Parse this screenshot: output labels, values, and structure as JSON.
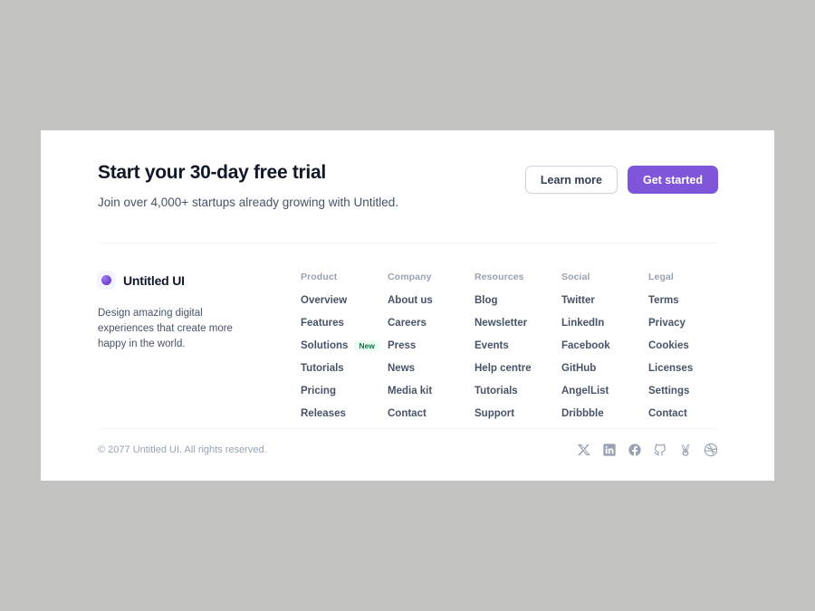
{
  "cta": {
    "title": "Start your 30-day free trial",
    "subtitle": "Join over 4,000+ startups already growing with Untitled.",
    "secondary_button": "Learn more",
    "primary_button": "Get started"
  },
  "brand": {
    "name": "Untitled UI",
    "description": "Design amazing digital experiences that create more happy in the world.",
    "logo_icon": "untitled-ui-dot-logo",
    "accent_color": "#7F56D9"
  },
  "link_columns": [
    {
      "title": "Product",
      "links": [
        {
          "label": "Overview"
        },
        {
          "label": "Features"
        },
        {
          "label": "Solutions",
          "badge": "New"
        },
        {
          "label": "Tutorials"
        },
        {
          "label": "Pricing"
        },
        {
          "label": "Releases"
        }
      ]
    },
    {
      "title": "Company",
      "links": [
        {
          "label": "About us"
        },
        {
          "label": "Careers"
        },
        {
          "label": "Press"
        },
        {
          "label": "News"
        },
        {
          "label": "Media kit"
        },
        {
          "label": "Contact"
        }
      ]
    },
    {
      "title": "Resources",
      "links": [
        {
          "label": "Blog"
        },
        {
          "label": "Newsletter"
        },
        {
          "label": "Events"
        },
        {
          "label": "Help centre"
        },
        {
          "label": "Tutorials"
        },
        {
          "label": "Support"
        }
      ]
    },
    {
      "title": "Social",
      "links": [
        {
          "label": "Twitter"
        },
        {
          "label": "LinkedIn"
        },
        {
          "label": "Facebook"
        },
        {
          "label": "GitHub"
        },
        {
          "label": "AngelList"
        },
        {
          "label": "Dribbble"
        }
      ]
    },
    {
      "title": "Legal",
      "links": [
        {
          "label": "Terms"
        },
        {
          "label": "Privacy"
        },
        {
          "label": "Cookies"
        },
        {
          "label": "Licenses"
        },
        {
          "label": "Settings"
        },
        {
          "label": "Contact"
        }
      ]
    }
  ],
  "bottom": {
    "copyright": "© 2077 Untitled UI. All rights reserved.",
    "social_icons": [
      {
        "name": "x-twitter-icon"
      },
      {
        "name": "linkedin-icon"
      },
      {
        "name": "facebook-icon"
      },
      {
        "name": "github-icon"
      },
      {
        "name": "angellist-icon"
      },
      {
        "name": "dribbble-icon"
      }
    ]
  },
  "colors": {
    "page_background": "#C3C3C2",
    "card_background": "#FFFFFF",
    "primary": "#7F56D9",
    "text_dark": "#101828",
    "text_muted": "#475467",
    "text_light": "#98A2B3",
    "badge_green": "#027A48",
    "badge_green_bg": "#ECFDF3",
    "divider": "#F2F4F7"
  }
}
